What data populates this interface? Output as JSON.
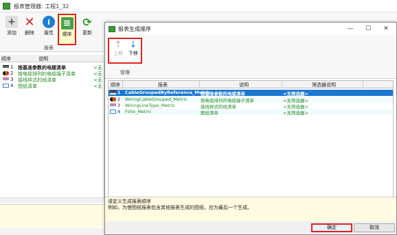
{
  "main_window": {
    "title": "报表管理器: 工程1_32",
    "ribbon": {
      "add": "添加",
      "delete": "删除",
      "properties": "属性",
      "order": "顺序",
      "update": "更新",
      "group": "报表"
    },
    "columns": [
      "顺序",
      "说明"
    ],
    "rows": [
      {
        "num": "1",
        "text": "按基准参数的电缆清单",
        "suffix": "<无",
        "style": "bold",
        "icon": "bold-list-icon"
      },
      {
        "num": "2",
        "text": "按电缆排列的电缆端子清单",
        "suffix": "<无",
        "style": "green",
        "icon": "cable-icon"
      },
      {
        "num": "3",
        "text": "接线样式的线清单",
        "suffix": "<无",
        "style": "green",
        "icon": "wiring-icon"
      },
      {
        "num": "4",
        "text": "图纸清单",
        "suffix": "<无",
        "style": "green",
        "icon": "folio-icon"
      }
    ]
  },
  "dialog": {
    "title": "报表生成顺序",
    "ribbon": {
      "move_up": "上移",
      "move_down": "下移",
      "group": "管理"
    },
    "columns": [
      "顺序",
      "报表",
      "说明",
      "筛选器说明"
    ],
    "rows": [
      {
        "num": "1",
        "report": "CableGroupedByReference_Metric",
        "desc": "按基准参数的电缆清单",
        "filter": "<无筛选器>",
        "selected": true,
        "icon": "bold-list-icon"
      },
      {
        "num": "2",
        "report": "WiringCableGrouped_Metric",
        "desc": "按电缆排列的电缆端子清单",
        "filter": "<无筛选器>",
        "selected": false,
        "icon": "cable-icon"
      },
      {
        "num": "3",
        "report": "WiringLineType_Metric",
        "desc": "接线样式的线清单",
        "filter": "<无筛选器>",
        "selected": false,
        "icon": "wiring-icon"
      },
      {
        "num": "4",
        "report": "Folio_Metric",
        "desc": "图纸清单",
        "filter": "<无筛选器>",
        "selected": false,
        "icon": "folio-icon"
      }
    ],
    "description": {
      "line1": "请定义生成报表顺序",
      "line2": "例如，为使图纸报表包含其他报表生成的图纸，应为最后一个生成。"
    },
    "ok": "确定",
    "cancel": "取消"
  },
  "colors": {
    "selection": "#1a78d0",
    "highlight_border": "#e02020",
    "green_text": "#1e8a1e",
    "description_bg": "#fffbe0"
  }
}
